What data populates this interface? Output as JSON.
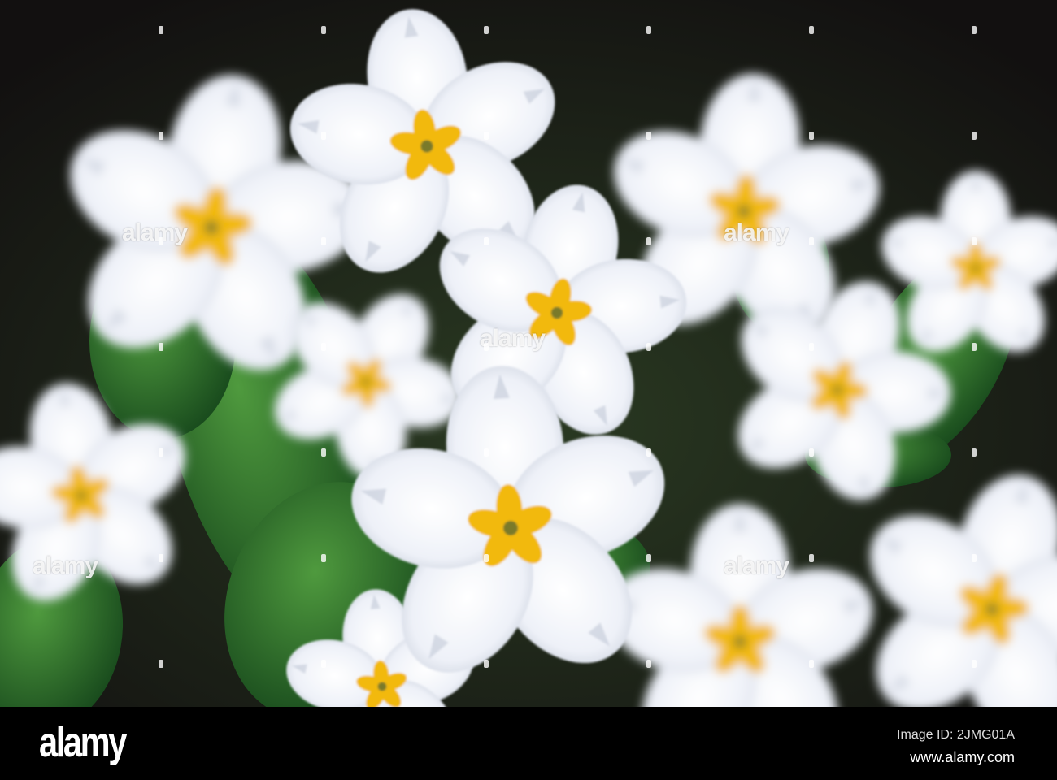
{
  "photo": {
    "subject": "White primrose flowers with yellow centers",
    "colors": {
      "petal": "#f4f6fb",
      "center": "#f2b90f",
      "leaf": "#2e7a2e",
      "background": "#141212"
    }
  },
  "watermark": {
    "text": "alamy"
  },
  "footer": {
    "logo": "alamy",
    "image_id": "Image ID: 2JMG01A",
    "site": "www.alamy.com"
  }
}
